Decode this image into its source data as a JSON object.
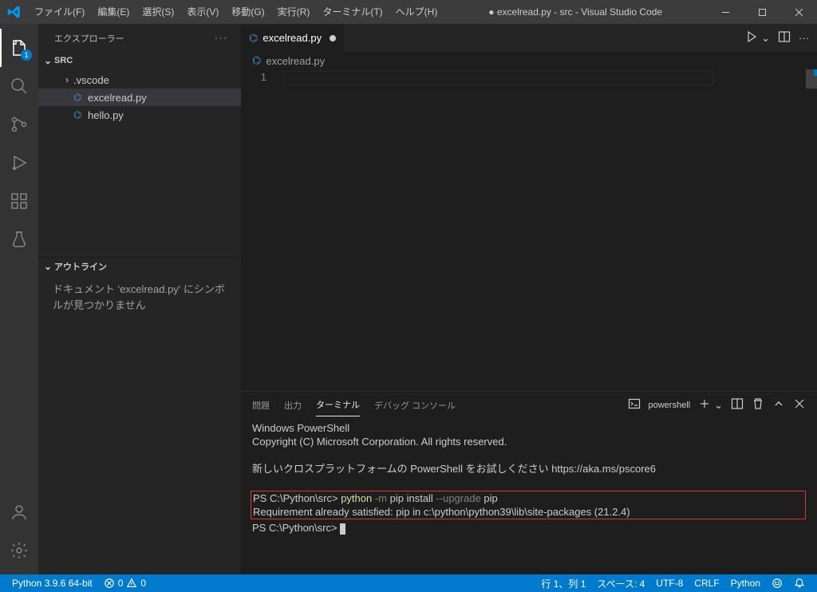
{
  "titlebar": {
    "menus": [
      "ファイル(F)",
      "編集(E)",
      "選択(S)",
      "表示(V)",
      "移動(G)",
      "実行(R)",
      "ターミナル(T)",
      "ヘルプ(H)"
    ],
    "title": "● excelread.py - src - Visual Studio Code"
  },
  "activitybar": {
    "explorer_badge": "1"
  },
  "sidebar": {
    "explorer_label": "エクスプローラー",
    "root": "SRC",
    "items": [
      {
        "label": ".vscode",
        "kind": "folder"
      },
      {
        "label": "excelread.py",
        "kind": "python",
        "selected": true
      },
      {
        "label": "hello.py",
        "kind": "python"
      }
    ],
    "outline_label": "アウトライン",
    "outline_body": "ドキュメント 'excelread.py' にシンボルが見つかりません"
  },
  "tabs": {
    "open": "excelread.py"
  },
  "breadcrumb": {
    "file": "excelread.py"
  },
  "editor": {
    "line_number": "1"
  },
  "panel": {
    "tabs": [
      "問題",
      "出力",
      "ターミナル",
      "デバッグ コンソール"
    ],
    "active_tab_index": 2,
    "shell_label": "powershell"
  },
  "terminal": {
    "l1": "Windows PowerShell",
    "l2": "Copyright (C) Microsoft Corporation. All rights reserved.",
    "l3": "新しいクロスプラットフォームの PowerShell をお試しください https://aka.ms/pscore6",
    "prompt1": "PS C:\\Python\\src> ",
    "cmd_py": "python",
    "cmd_mid1": " -m ",
    "cmd_bold1": "pip install",
    "cmd_mid2": " --upgrade ",
    "cmd_bold2": "pip",
    "result": "Requirement already satisfied: pip in c:\\python\\python39\\lib\\site-packages (21.2.4)",
    "prompt2": "PS C:\\Python\\src> "
  },
  "statusbar": {
    "python": "Python 3.9.6 64-bit",
    "errors": "0",
    "warnings": "0",
    "ln_col": "行 1、列 1",
    "spaces": "スペース: 4",
    "encoding": "UTF-8",
    "eol": "CRLF",
    "lang": "Python"
  }
}
